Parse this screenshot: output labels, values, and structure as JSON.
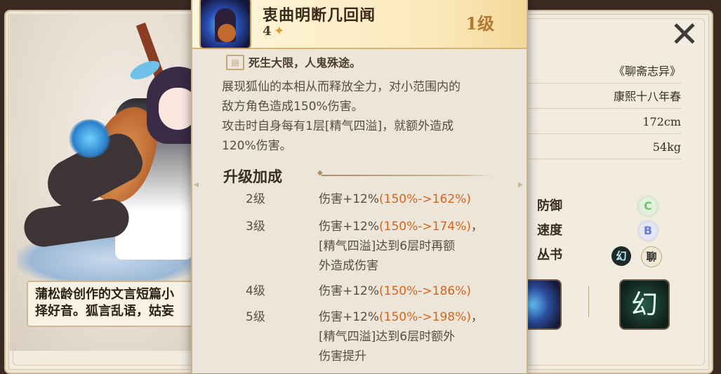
{
  "card": {
    "description": "蒲松龄创作的文言短篇小说，异史氏曰：择好音。狐言乱语，姑妄听之",
    "description_line1": "蒲松龄创作的文言短篇小",
    "description_line2": "择好音。狐言乱语，姑妄"
  },
  "info": {
    "source": "《聊斋志异》",
    "date": "康熙十八年春",
    "height": "172cm",
    "weight": "54kg"
  },
  "stats": [
    {
      "label": "防御",
      "value": "C"
    },
    {
      "label": "速度",
      "value": "B"
    },
    {
      "label": "丛书",
      "value": ""
    }
  ],
  "icons": {
    "close": "close-icon",
    "book_a": "幻",
    "book_b": "聊",
    "skill_right": "幻"
  },
  "popup": {
    "skill_name": "衷曲明断几回闻",
    "cost": "4",
    "level": "1级",
    "quote": "死生大限，人鬼殊途。",
    "description_lines": [
      "展现狐仙的本相从而释放全力，对小范围内的",
      "敌方角色造成150%伤害。",
      "攻击时自身每有1层[精气四溢]，就额外造成",
      "120%伤害。"
    ],
    "upgrade_title": "升级加成",
    "upgrades": [
      {
        "level": "2级",
        "prefix": "伤害+12%",
        "change": "(150%->162%)",
        "extra": ""
      },
      {
        "level": "3级",
        "prefix": "伤害+12%",
        "change": "(150%->174%)",
        "suffix": "，",
        "extra_lines": [
          "[精气四溢]达到6层时再额",
          "外造成伤害"
        ]
      },
      {
        "level": "4级",
        "prefix": "伤害+12%",
        "change": "(150%->186%)",
        "extra": ""
      },
      {
        "level": "5级",
        "prefix": "伤害+12%",
        "change": "(150%->198%)",
        "suffix": "，",
        "extra_lines": [
          "[精气四溢]达到6层时额外",
          "伤害提升"
        ]
      }
    ]
  }
}
